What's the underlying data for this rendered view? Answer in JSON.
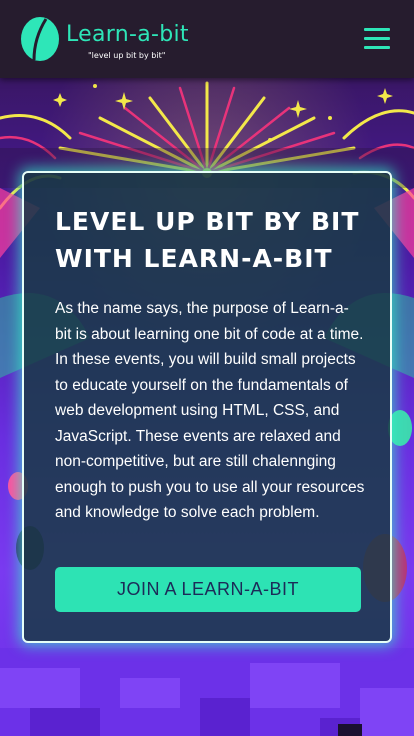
{
  "nav": {
    "title": "Learn-a-bit",
    "tagline": "\"level up bit by bit\"",
    "logo_icon": "leaf-logo-icon",
    "menu_icon": "hamburger-menu-icon"
  },
  "hero": {
    "heading": "LEVEL UP BIT BY BIT WITH LEARN-A-BIT",
    "body": "As the name says, the purpose of Learn-a-bit is about learning one bit of code at a time. In these events, you will build small projects to educate yourself on the fundamentals of web development using HTML, CSS, and JavaScript. These events are relaxed and non-competitive, but are still chalennging enough to push you to use all your resources and knowledge to solve each problem.",
    "cta_label": "JOIN A LEARN-A-BIT"
  },
  "colors": {
    "accent": "#2ee6b8",
    "navbar": "#261c2e",
    "card_bg": "#183a46",
    "background": "#5a1fc2"
  }
}
